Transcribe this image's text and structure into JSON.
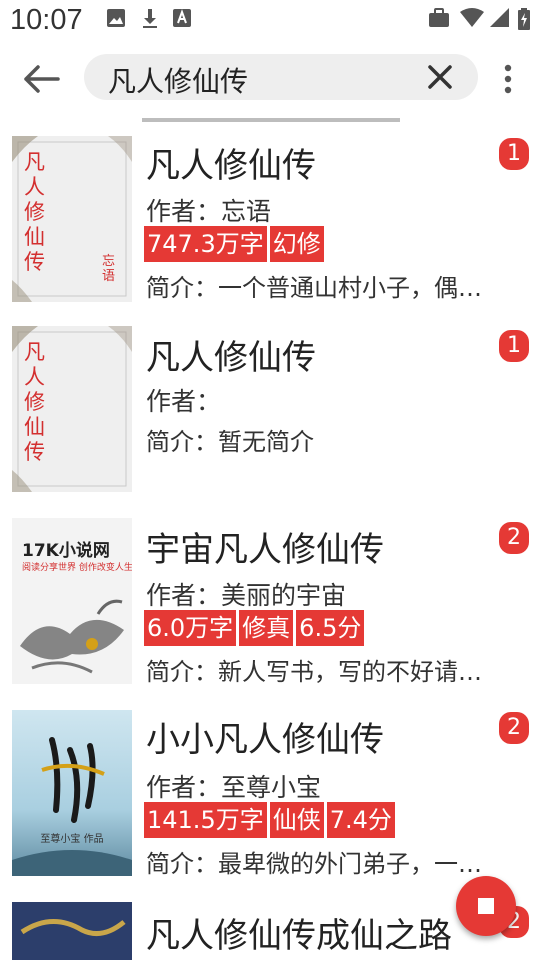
{
  "status_bar": {
    "time": "10:07"
  },
  "search": {
    "query": "凡人修仙传"
  },
  "results": [
    {
      "title": "凡人修仙传",
      "author": "作者：忘语",
      "tags": [
        "747.3万字",
        "幻修"
      ],
      "intro": "简介：一个普通山村小子，偶然下进入到当地江湖小门派",
      "badge": "1",
      "cover_text": "凡人修仙传",
      "cover_author": "忘语"
    },
    {
      "title": "凡人修仙传",
      "author": "作者：",
      "tags": [],
      "intro": "简介：暂无简介",
      "badge": "1",
      "cover_text": "凡人修仙传"
    },
    {
      "title": "宇宙凡人修仙传",
      "author": "作者：美丽的宇宙",
      "tags": [
        "6.0万字",
        "修真",
        "6.5分"
      ],
      "intro": "简介：新人写书，写的不好请见谅",
      "badge": "2",
      "cover_brand": "17K小说网",
      "cover_slogan": "阅读分享世界 创作改变人生"
    },
    {
      "title": "小小凡人修仙传",
      "author": "作者：至尊小宝",
      "tags": [
        "141.5万字",
        "仙侠",
        "7.4分"
      ],
      "intro": "简介：最卑微的外门弟子，一步步走向巅峰",
      "badge": "2",
      "cover_caption": "至尊小宝 作品"
    },
    {
      "title": "凡人修仙传成仙之路",
      "badge": "2"
    }
  ],
  "colors": {
    "accent": "#e53935"
  },
  "icons": {
    "back": "arrow-left-icon",
    "clear": "close-icon",
    "more": "more-vert-icon",
    "fab": "stop-icon"
  }
}
